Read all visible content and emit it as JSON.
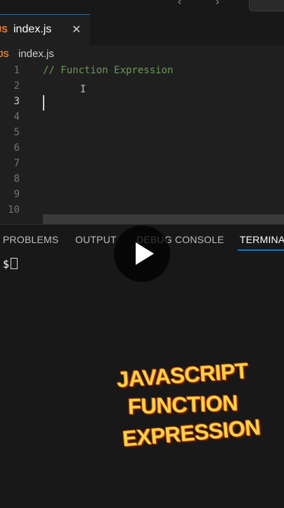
{
  "top_bar": {
    "nav_arrows": "‹ ›"
  },
  "editor_tab": {
    "icon": "JS",
    "label": "index.js",
    "close": "✕"
  },
  "breadcrumb": {
    "icon": "JS",
    "label": "index.js"
  },
  "editor": {
    "lines": [
      {
        "number": "1",
        "code": "// Function Expression"
      },
      {
        "number": "2",
        "code": ""
      },
      {
        "number": "3",
        "code": ""
      },
      {
        "number": "4",
        "code": ""
      },
      {
        "number": "5",
        "code": ""
      },
      {
        "number": "6",
        "code": ""
      },
      {
        "number": "7",
        "code": ""
      },
      {
        "number": "8",
        "code": ""
      },
      {
        "number": "9",
        "code": ""
      },
      {
        "number": "10",
        "code": ""
      }
    ],
    "active_line": 3
  },
  "panel": {
    "tabs": [
      "PROBLEMS",
      "OUTPUT",
      "DEBUG CONSOLE",
      "TERMINAL"
    ],
    "active_tab": "TERMINAL",
    "terminal_prompt": "$"
  },
  "overlay": {
    "lines": [
      "JAVASCRIPT",
      "FUNCTION",
      "EXPRESSION"
    ]
  },
  "colors": {
    "comment": "#6a9955",
    "accent": "#0078d4",
    "js_icon": "#e9833a",
    "overlay_text": "#fbd24a"
  }
}
